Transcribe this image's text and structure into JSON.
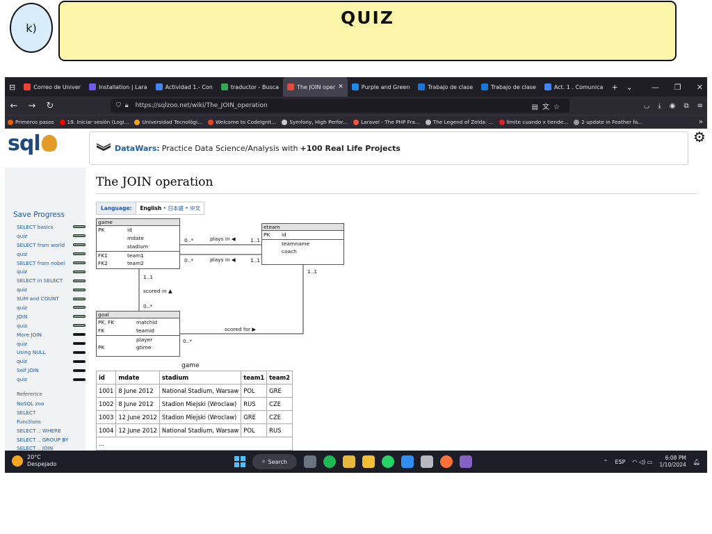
{
  "slide": {
    "letter": "k)",
    "title": "QUIZ"
  },
  "browser": {
    "tabs": [
      {
        "label": "Correo de Univer",
        "color": "#ea4335"
      },
      {
        "label": "Installation | Lara",
        "color": "#6c5ce7"
      },
      {
        "label": "Actividad 1.- Con",
        "color": "#4285f4"
      },
      {
        "label": "traductor - Busca",
        "color": "#34a853"
      },
      {
        "label": "The JOIN oper",
        "color": "#e04b3a",
        "active": true
      },
      {
        "label": "Purple and Green",
        "color": "#1e88e5"
      },
      {
        "label": "Trabajo de clase",
        "color": "#1976d2"
      },
      {
        "label": "Trabajo de clase",
        "color": "#1976d2"
      },
      {
        "label": "Act. 1 . Comunica",
        "color": "#4285f4"
      }
    ],
    "url": "https://sqlzoo.net/wiki/The_JOIN_operation",
    "bookmarks": [
      {
        "label": "Primeros pasos",
        "color": "#e66000"
      },
      {
        "label": "19. Iniciar sesión (Logi...",
        "color": "#ff0000"
      },
      {
        "label": "Universidad Tecnológi...",
        "color": "#f0a30a"
      },
      {
        "label": "Welcome to CodeIgnit...",
        "color": "#ee4323"
      },
      {
        "label": "Symfony, High Perfor...",
        "color": "#cccccc"
      },
      {
        "label": "Laravel - The PHP Fra...",
        "color": "#f05340"
      },
      {
        "label": "The Legend of Zelda: ...",
        "color": "#bbbbbb"
      },
      {
        "label": "límite cuando x tiende...",
        "color": "#e41e2b"
      },
      {
        "label": "2 update in Feather fa...",
        "color": "#999999"
      }
    ]
  },
  "page": {
    "logo": "sql",
    "banner": {
      "brand": "DataWars:",
      "text": "Practice Data Science/Analysis with",
      "bold": "+100 Real Life Projects"
    },
    "title": "The JOIN operation",
    "language": {
      "label": "Language:",
      "current": "English",
      "others": "• 日本語 • 中文"
    },
    "sidebar": {
      "header": "Save Progress",
      "items": [
        {
          "label": "SELECT basics",
          "done": true
        },
        {
          "label": "quiz",
          "done": true
        },
        {
          "label": "SELECT from world",
          "done": true
        },
        {
          "label": "quiz",
          "done": true
        },
        {
          "label": "SELECT from nobel",
          "done": true
        },
        {
          "label": "quiz",
          "done": true
        },
        {
          "label": "SELECT in SELECT",
          "done": true
        },
        {
          "label": "quiz",
          "done": true
        },
        {
          "label": "SUM and COUNT",
          "done": true
        },
        {
          "label": "quiz",
          "done": true
        },
        {
          "label": "JOIN",
          "done": true
        },
        {
          "label": "quiz",
          "done": true
        },
        {
          "label": "More JOIN",
          "done": false
        },
        {
          "label": "quiz",
          "done": false
        },
        {
          "label": "Using NULL",
          "done": false
        },
        {
          "label": "quiz",
          "done": false
        },
        {
          "label": "Self JOIN",
          "done": false
        },
        {
          "label": "quiz",
          "done": false
        }
      ],
      "reference_label": "Reference",
      "references": [
        "NoSQL zoo",
        "SELECT",
        "Functions",
        "SELECT .. WHERE",
        "SELECT .. GROUP BY",
        "SELECT .. JOIN"
      ]
    },
    "er": {
      "game": {
        "name": "game",
        "pk": "PK",
        "fk1": "FK1",
        "fk2": "FK2",
        "f_id": "id",
        "f_mdate": "mdate",
        "f_stadium": "stadium",
        "f_team1": "team1",
        "f_team2": "team2"
      },
      "eteam": {
        "name": "eteam",
        "pk": "PK",
        "f_id": "id",
        "f_teamname": "teamname",
        "f_coach": "coach"
      },
      "goal": {
        "name": "goal",
        "pkfk": "PK, FK",
        "fk": "FK",
        "pk": "PK",
        "f_matchid": "matchid",
        "f_teamid": "teamid",
        "f_player": "player",
        "f_gtime": "gtime"
      },
      "rel": {
        "plays1": "plays in ◀",
        "plays2": "plays in ◀",
        "card_a": "0..*",
        "card_b": "1..1",
        "card_c": "0..*",
        "card_d": "1..1",
        "scored": "scored in ▲",
        "card_e": "1..1",
        "card_f": "0..*",
        "scoredfor": "scored for ▶",
        "card_g": "1..1",
        "card_h": "0..*"
      }
    },
    "table": {
      "caption": "game",
      "headers": [
        "id",
        "mdate",
        "stadium",
        "team1",
        "team2"
      ],
      "rows": [
        [
          "1001",
          "8 June 2012",
          "National Stadium, Warsaw",
          "POL",
          "GRE"
        ],
        [
          "1002",
          "8 June 2012",
          "Stadion Miejski (Wroclaw)",
          "RUS",
          "CZE"
        ],
        [
          "1003",
          "12 June 2012",
          "Stadion Miejski (Wroclaw)",
          "GRE",
          "CZE"
        ],
        [
          "1004",
          "12 June 2012",
          "National Stadium, Warsaw",
          "POL",
          "RUS"
        ]
      ],
      "ellipsis": "..."
    }
  },
  "taskbar": {
    "temp": "20°C",
    "weather": "Despejado",
    "search": "Search",
    "lang": "ESP",
    "time": "6:08 PM",
    "date": "1/10/2024"
  }
}
